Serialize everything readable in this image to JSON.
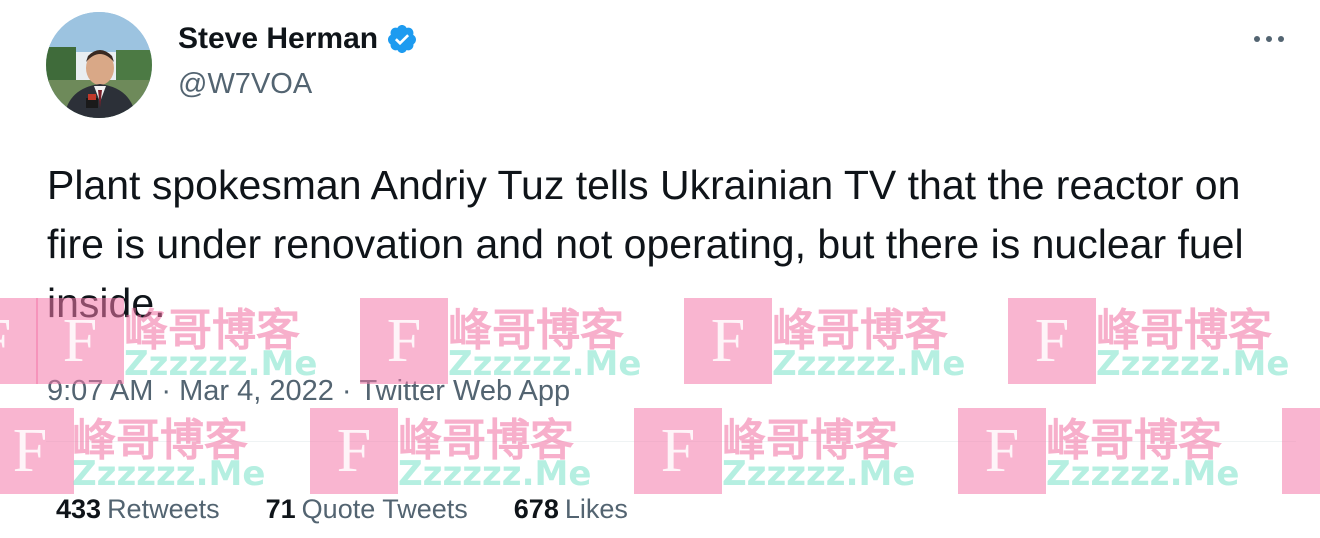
{
  "author": {
    "name": "Steve Herman",
    "handle": "@W7VOA",
    "verified": true
  },
  "tweet": {
    "text": "Plant spokesman Andriy Tuz tells Ukrainian TV that the reactor on fire is under renovation and not operating, but there is nuclear fuel inside.",
    "time": "9:07 AM",
    "date": "Mar 4, 2022",
    "separator": "·",
    "source": "Twitter Web App"
  },
  "stats": {
    "retweets": {
      "count": "433",
      "label": "Retweets"
    },
    "quote_tweets": {
      "count": "71",
      "label": "Quote Tweets"
    },
    "likes": {
      "count": "678",
      "label": "Likes"
    }
  },
  "watermark": {
    "logo_letter": "F",
    "cn_text": "峰哥博客",
    "en_text": "Zzzzzz.Me"
  },
  "icons": {
    "verified": "verified-badge-icon",
    "more": "more-horizontal-icon"
  },
  "colors": {
    "text_primary": "#0f1419",
    "text_secondary": "#536471",
    "verified_blue": "#1d9bf0",
    "watermark_pink": "#f06ea0",
    "watermark_teal": "#78e1c8"
  }
}
